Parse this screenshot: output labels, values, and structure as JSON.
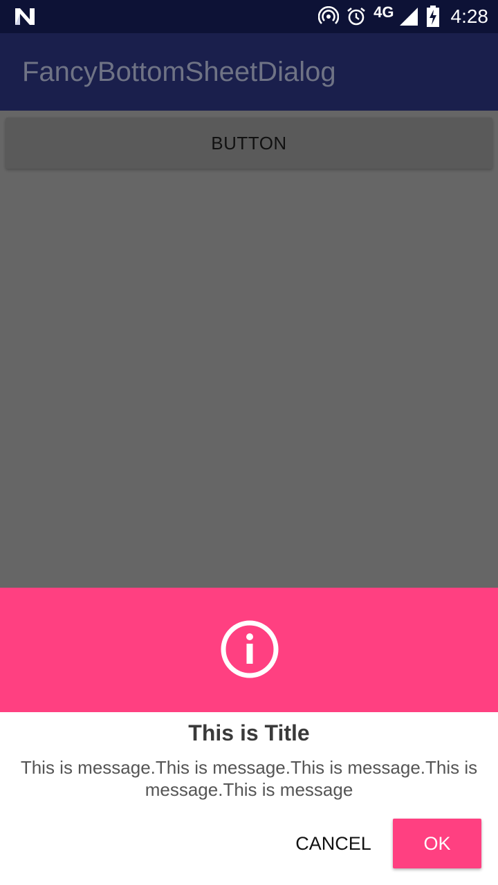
{
  "status_bar": {
    "network": "4G",
    "time": "4:28",
    "icons": [
      "n-logo-icon",
      "hotspot-icon",
      "alarm-icon",
      "signal-icon",
      "battery-charging-icon"
    ]
  },
  "app_bar": {
    "title": "FancyBottomSheetDialog"
  },
  "main": {
    "button_label": "BUTTON"
  },
  "dialog": {
    "icon": "info-icon",
    "title": "This is Title",
    "message": "This is message.This is message.This is message.This is message.This is message",
    "cancel_label": "CANCEL",
    "ok_label": "OK",
    "colors": {
      "accent": "#ff4081",
      "scrim": "#666666",
      "app_bar": "#1a1f4c",
      "status_bar": "#0d1236"
    }
  }
}
